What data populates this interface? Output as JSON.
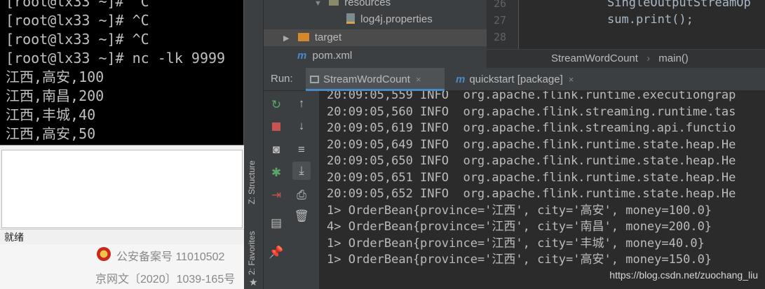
{
  "terminal": {
    "lines": [
      "[root@lx33 ~]# ^C",
      "[root@lx33 ~]# ^C",
      "[root@lx33 ~]# ^C",
      "[root@lx33 ~]# nc -lk 9999",
      "江西,高安,100",
      "江西,南昌,200",
      "江西,丰城,40",
      "江西,高安,50"
    ]
  },
  "status_text": "就绪",
  "webpage": {
    "beian": "公安备案号 11010502",
    "wenwei": "京网文〔2020〕1039-165号"
  },
  "ide": {
    "side_labels": {
      "structure": "Z: Structure",
      "favorites": "2: Favorites"
    },
    "project_tree": [
      {
        "label": "resources",
        "icon": "folder-icon"
      },
      {
        "label": "log4j.properties",
        "icon": "properties-file-icon"
      },
      {
        "label": "target",
        "icon": "folder-icon"
      },
      {
        "label": "pom.xml",
        "icon": "maven-icon"
      }
    ],
    "editor": {
      "line_numbers": [
        "26",
        "27",
        "28"
      ],
      "code_lines": [
        "SingleOutputStreamOp",
        "sum.print();",
        ""
      ],
      "breadcrumb": [
        "StreamWordCount",
        "main()"
      ],
      "breadcrumb_separator": "›"
    },
    "run": {
      "label": "Run:",
      "tabs": [
        {
          "label": "StreamWordCount",
          "close": "×"
        },
        {
          "label": "quickstart [package]",
          "close": "×"
        }
      ],
      "toolbar_icons": [
        "rerun-icon",
        "up-arrow-icon",
        "stop-icon",
        "down-arrow-icon",
        "camera-icon",
        "soft-wrap-icon",
        "debug-icon",
        "scroll-to-end-icon",
        "exit-icon",
        "print-icon",
        "layout-icon",
        "trash-icon",
        "pin-icon"
      ]
    },
    "console_lines": [
      "20:09:05,559 INFO  org.apache.flink.runtime.executiongrap",
      "20:09:05,560 INFO  org.apache.flink.streaming.runtime.tas",
      "20:09:05,619 INFO  org.apache.flink.streaming.api.functio",
      "20:09:05,649 INFO  org.apache.flink.runtime.state.heap.He",
      "20:09:05,650 INFO  org.apache.flink.runtime.state.heap.He",
      "20:09:05,651 INFO  org.apache.flink.runtime.state.heap.He",
      "20:09:05,652 INFO  org.apache.flink.runtime.state.heap.He",
      "1> OrderBean{province='江西', city='高安', money=100.0}",
      "4> OrderBean{province='江西', city='南昌', money=200.0}",
      "1> OrderBean{province='江西', city='丰城', money=40.0}",
      "1> OrderBean{province='江西', city='高安', money=150.0}"
    ],
    "watermark": "https://blog.csdn.net/zuochang_liu"
  },
  "colors": {
    "console_bg": "#2b2b2b",
    "console_text": "#bbbbbb",
    "accent": "#4a88c7"
  }
}
